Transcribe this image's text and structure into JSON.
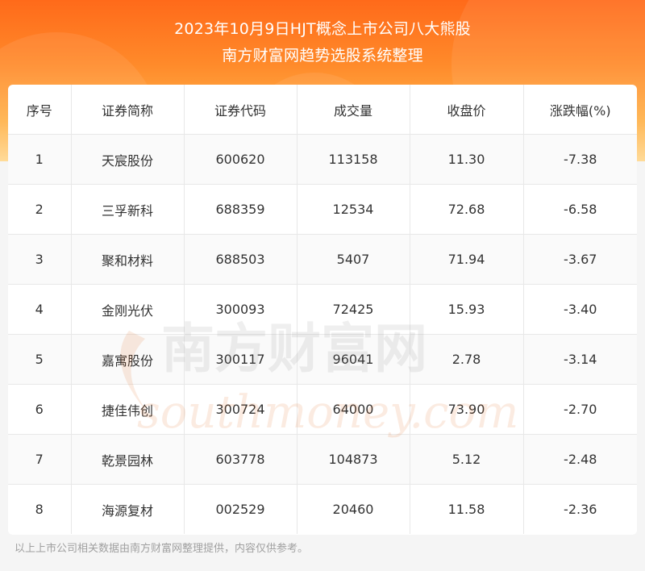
{
  "header": {
    "title_line1": "2023年10月9日HJT概念上市公司八大熊股",
    "title_line2": "南方财富网趋势选股系统整理"
  },
  "table": {
    "columns": [
      "序号",
      "证券简称",
      "证券代码",
      "成交量",
      "收盘价",
      "涨跌幅(%)"
    ],
    "rows": [
      [
        "1",
        "天宸股份",
        "600620",
        "113158",
        "11.30",
        "-7.38"
      ],
      [
        "2",
        "三孚新科",
        "688359",
        "12534",
        "72.68",
        "-6.58"
      ],
      [
        "3",
        "聚和材料",
        "688503",
        "5407",
        "71.94",
        "-3.67"
      ],
      [
        "4",
        "金刚光伏",
        "300093",
        "72425",
        "15.93",
        "-3.40"
      ],
      [
        "5",
        "嘉寓股份",
        "300117",
        "96041",
        "2.78",
        "-3.14"
      ],
      [
        "6",
        "捷佳伟创",
        "300724",
        "64000",
        "73.90",
        "-2.70"
      ],
      [
        "7",
        "乾景园林",
        "603778",
        "104873",
        "5.12",
        "-2.48"
      ],
      [
        "8",
        "海源复材",
        "002529",
        "20460",
        "11.58",
        "-2.36"
      ]
    ]
  },
  "watermark": {
    "cn": "南方财富网",
    "en": "southmoney.com"
  },
  "footer": {
    "note": "以上上市公司相关数据由南方财富网整理提供，内容仅供参考。"
  }
}
